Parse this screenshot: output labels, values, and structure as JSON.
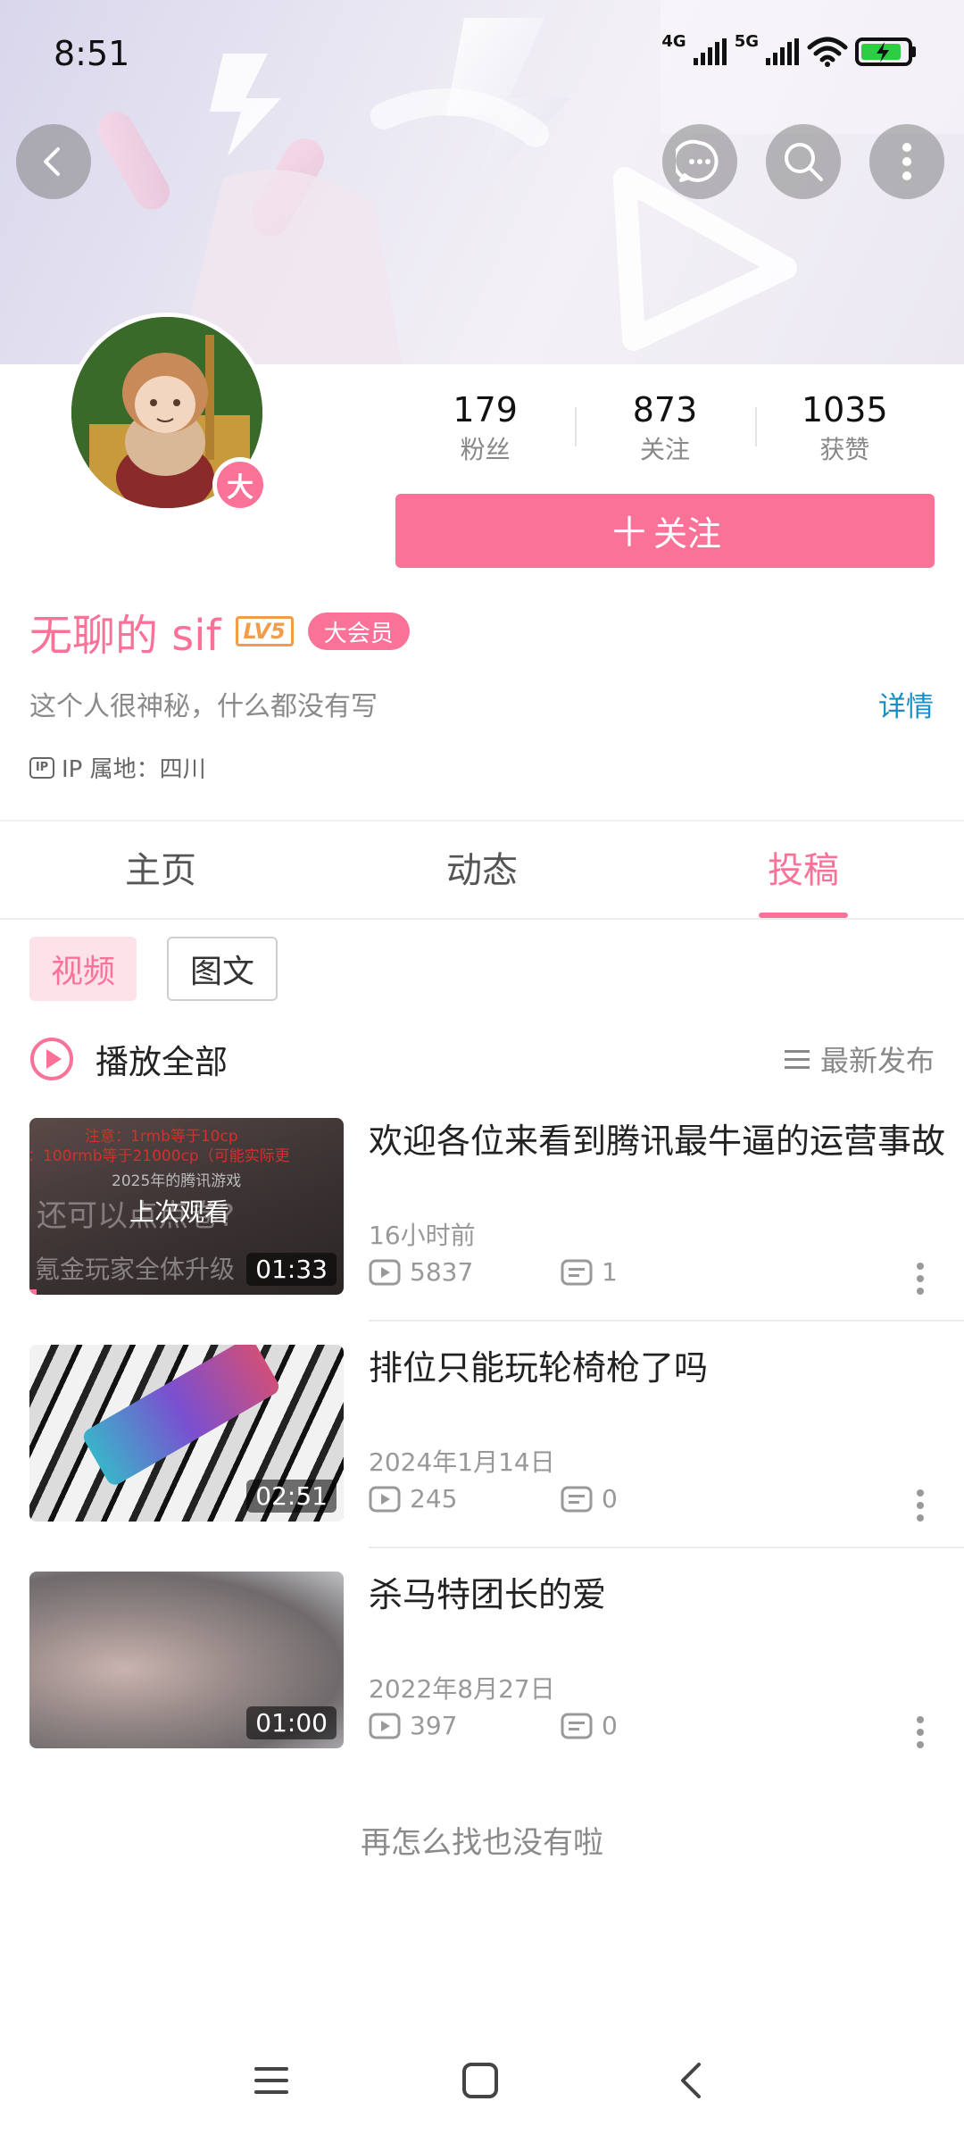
{
  "status_bar": {
    "time": "8:51",
    "network1": "4G",
    "network2": "5G"
  },
  "header": {
    "icons": [
      "back-icon",
      "message-icon",
      "search-icon",
      "more-vertical-icon"
    ]
  },
  "profile": {
    "vip_badge": "大",
    "stats": [
      {
        "value": "179",
        "label": "粉丝"
      },
      {
        "value": "873",
        "label": "关注"
      },
      {
        "value": "1035",
        "label": "获赞"
      }
    ],
    "follow_button": "关注",
    "follow_plus": "＋",
    "username": "无聊的 sif",
    "level": "LV5",
    "member_badge": "大会员",
    "bio": "这个人很神秘，什么都没有写",
    "detail_link": "详情",
    "ip_icon_text": "IP",
    "ip_location": "IP 属地：四川"
  },
  "tabs": [
    {
      "label": "主页",
      "active": false
    },
    {
      "label": "动态",
      "active": false
    },
    {
      "label": "投稿",
      "active": true
    }
  ],
  "filters": [
    {
      "label": "视频",
      "active": true
    },
    {
      "label": "图文",
      "active": false
    }
  ],
  "playall": {
    "label": "播放全部",
    "sort_label": "最新发布"
  },
  "videos": [
    {
      "title": "欢迎各位来看到腾讯最牛逼的运营事故",
      "date": "16小时前",
      "views": "5837",
      "comments": "1",
      "duration": "01:33",
      "watched_label": "上次观看",
      "thumb_text": {
        "line1": "注意：1rmb等于10cp",
        "line2": "：100rmb等于21000cp（可能实际更",
        "line3": "2025年的腾讯游戏",
        "line4": "还可以点点卷?",
        "line5": "氪金玩家全体升级"
      }
    },
    {
      "title": "排位只能玩轮椅枪了吗",
      "date": "2024年1月14日",
      "views": "245",
      "comments": "0",
      "duration": "02:51"
    },
    {
      "title": "杀马特团长的爱",
      "date": "2022年8月27日",
      "views": "397",
      "comments": "0",
      "duration": "01:00"
    }
  ],
  "end_text": "再怎么找也没有啦",
  "colors": {
    "accent": "#fb7299",
    "link": "#1a8dc4",
    "level": "#f29c4a"
  }
}
